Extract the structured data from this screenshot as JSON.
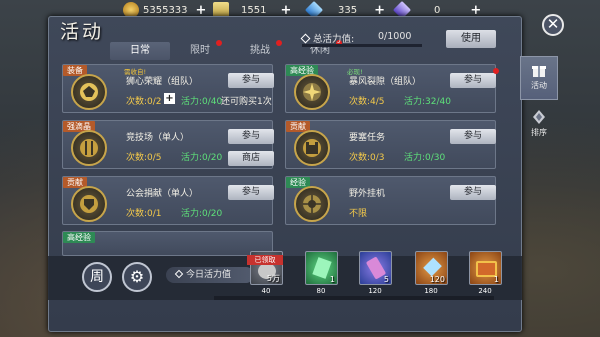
{
  "currencies": [
    {
      "name": "gold-coin-icon",
      "value": "5355333",
      "color": "#d8a63a"
    },
    {
      "name": "scroll-icon",
      "value": "1551",
      "color": "#d6c06a"
    },
    {
      "name": "blue-crystal-icon",
      "value": "335",
      "color": "#4fa5e6"
    },
    {
      "name": "purple-crystal-icon",
      "value": "0",
      "color": "#7f6ae0"
    }
  ],
  "panel": {
    "title": "活动",
    "tabs": [
      {
        "label": "日常",
        "active": true,
        "dot": false
      },
      {
        "label": "限时",
        "active": false,
        "dot": true
      },
      {
        "label": "挑战",
        "active": false,
        "dot": true
      },
      {
        "label": "休闲",
        "active": false,
        "dot": true
      }
    ],
    "total_label": "总活力值:",
    "total_value": "0/1000",
    "total_progress": 0,
    "use_button": "使用",
    "close_icon": "✕"
  },
  "cards": [
    {
      "tag": "装备",
      "tag_color": "orange",
      "badge": "需收自!",
      "name": "狮心荣耀（组队）",
      "count": "次数:0/2",
      "vitality": "活力:0/40",
      "extra": "还可购买1次",
      "button": "参与",
      "button2": "",
      "reddot": false
    },
    {
      "tag": "高经验",
      "tag_color": "green",
      "badge": "必现!",
      "name": "暴风裂隙（组队）",
      "count": "次数:4/5",
      "vitality": "活力:32/40",
      "extra": "",
      "button": "参与",
      "button2": "",
      "reddot": true
    },
    {
      "tag": "强滴晶",
      "tag_color": "orange",
      "badge": "",
      "name": "竞技场（单人）",
      "count": "次数:0/5",
      "vitality": "活力:0/20",
      "extra": "",
      "button": "参与",
      "button2": "商店",
      "reddot": false
    },
    {
      "tag": "贡献",
      "tag_color": "orange",
      "badge": "",
      "name": "要塞任务",
      "count": "次数:0/3",
      "vitality": "活力:0/30",
      "extra": "",
      "button": "参与",
      "button2": "",
      "reddot": false
    },
    {
      "tag": "贡献",
      "tag_color": "orange",
      "badge": "",
      "name": "公会捐献（单人）",
      "count": "次数:0/1",
      "vitality": "活力:0/20",
      "extra": "",
      "button": "参与",
      "button2": "",
      "reddot": false
    },
    {
      "tag": "经验",
      "tag_color": "green",
      "badge": "",
      "name": "野外挂机",
      "count": "不限",
      "vitality": "",
      "extra": "",
      "button": "参与",
      "button2": "",
      "reddot": false
    }
  ],
  "partial_card": {
    "tag": "高经验"
  },
  "side_tabs": [
    {
      "label": "活动",
      "icon": "gift-icon",
      "active": true
    },
    {
      "label": "排序",
      "icon": "ranking-icon",
      "active": false
    }
  ],
  "bottom": {
    "week_label": "周",
    "gear_icon": "gear-icon",
    "today_label": "今日活力值",
    "progress": 0,
    "rewards": [
      {
        "threshold": "40",
        "icon": "coin-pouch-icon",
        "count": "5万",
        "claimed_label": "已领取",
        "color": "#5a5f68"
      },
      {
        "threshold": "80",
        "icon": "emerald-icon",
        "count": "1",
        "claimed_label": "",
        "color": "#2b8b4a"
      },
      {
        "threshold": "120",
        "icon": "scroll-pink-icon",
        "count": "5",
        "claimed_label": "",
        "color": "#4a6dcf"
      },
      {
        "threshold": "180",
        "icon": "ice-crystal-icon",
        "count": "120",
        "claimed_label": "",
        "color": "#cf7a2b"
      },
      {
        "threshold": "240",
        "icon": "treasure-chest-icon",
        "count": "1",
        "claimed_label": "",
        "color": "#cf7a2b"
      }
    ]
  }
}
